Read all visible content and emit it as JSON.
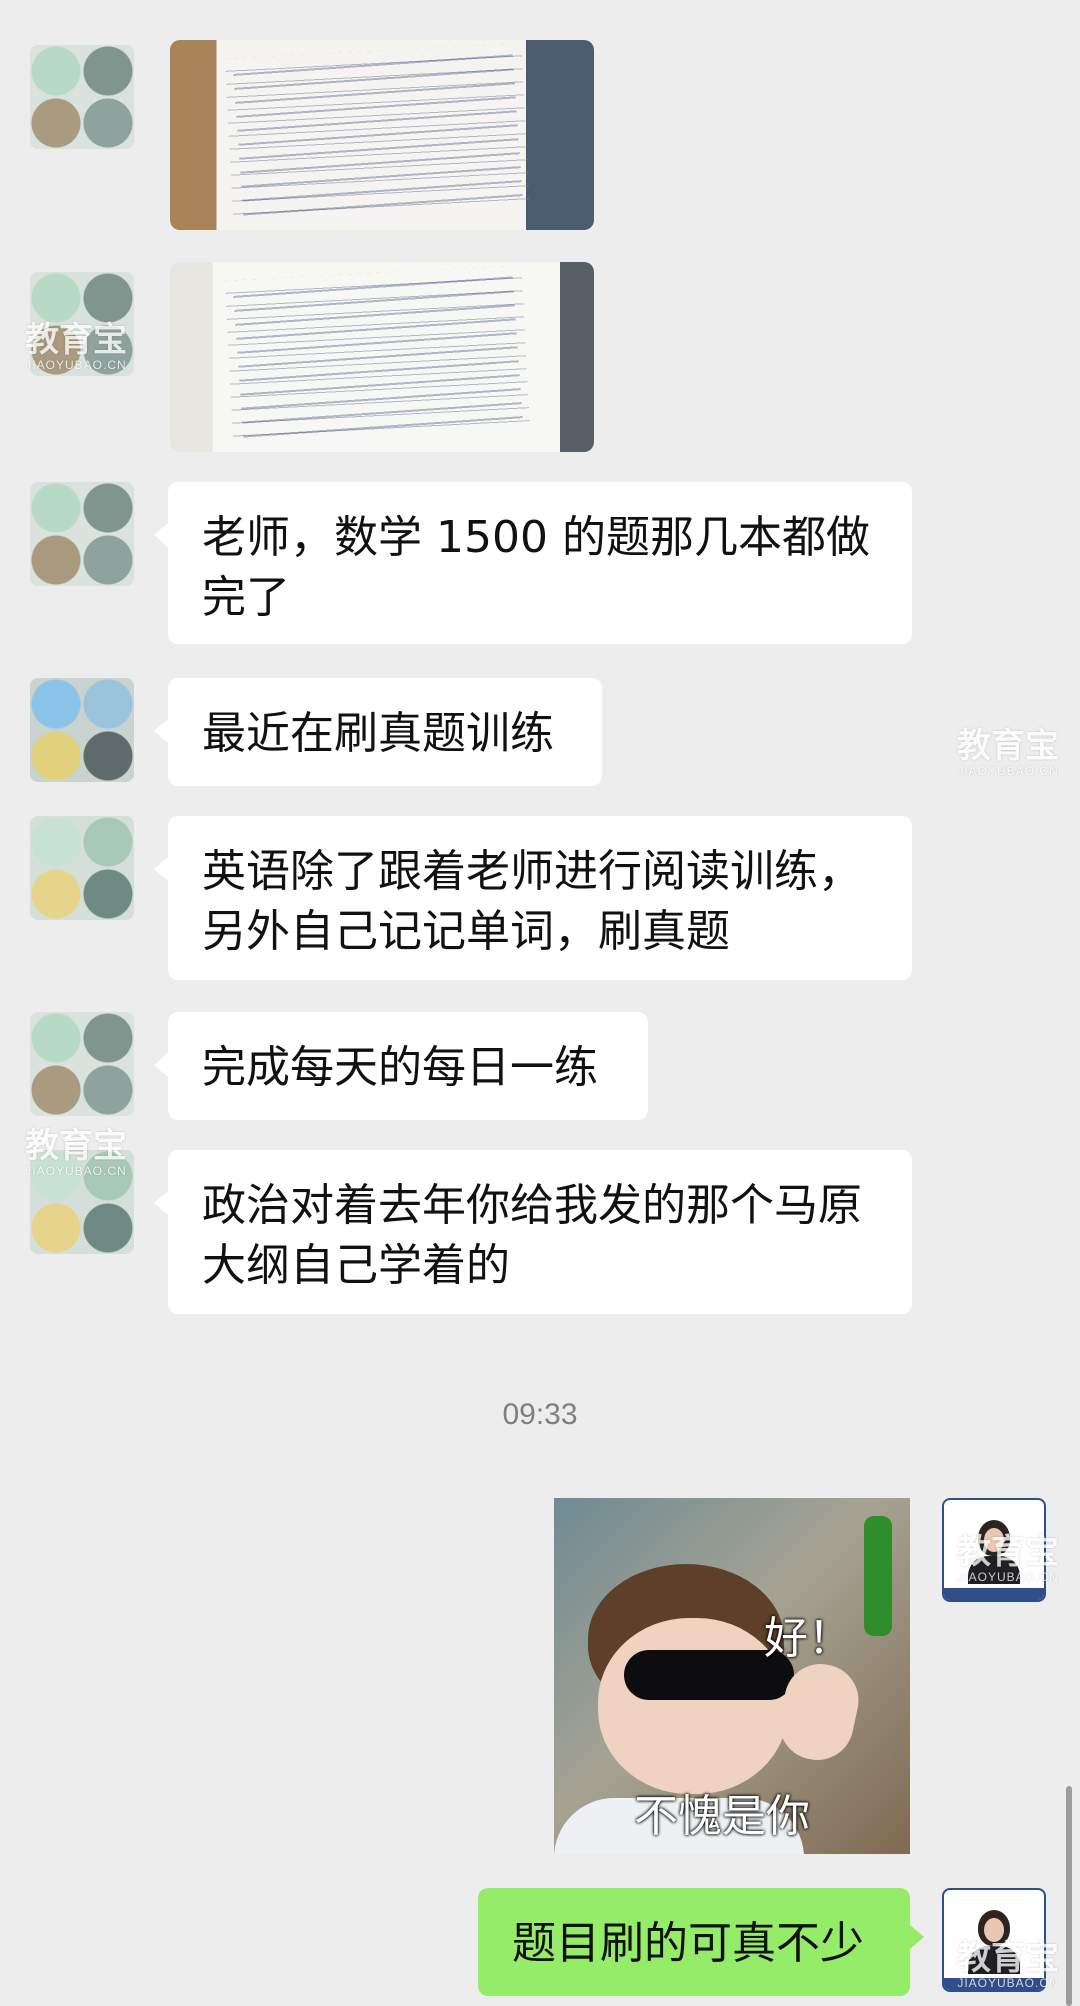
{
  "messages": {
    "m1": "老师，数学 1500 的题那几本都做完了",
    "m2": "最近在刷真题训练",
    "m3": "英语除了跟着老师进行阅读训练，另外自己记记单词，刷真题",
    "m4": "完成每天的每日一练",
    "m5": "政治对着去年你给我发的那个马原大纲自己学着的",
    "time": "09:33",
    "sticker_top": "好！",
    "sticker_bottom": "不愧是你",
    "m6": "题目刷的可真不少"
  },
  "watermark": {
    "title": "教育宝",
    "subtitle": "JIAOYUBAO.CN"
  },
  "colors": {
    "background": "#ededed",
    "incoming_bubble": "#ffffff",
    "outgoing_bubble": "#95ec69",
    "timestamp": "#7f7f7f"
  }
}
